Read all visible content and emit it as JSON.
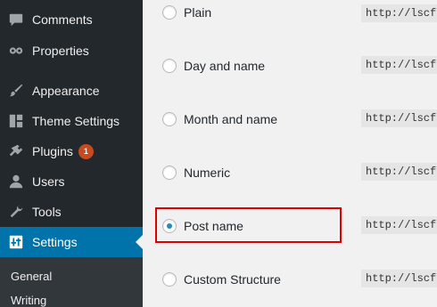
{
  "sidebar": {
    "items": [
      {
        "label": "Comments",
        "icon": "comment-icon"
      },
      {
        "label": "Properties",
        "icon": "owl-icon"
      },
      {
        "label": "Appearance",
        "icon": "paintbrush-icon"
      },
      {
        "label": "Theme Settings",
        "icon": "layout-icon"
      },
      {
        "label": "Plugins",
        "icon": "plugin-icon",
        "badge": "1"
      },
      {
        "label": "Users",
        "icon": "user-icon"
      },
      {
        "label": "Tools",
        "icon": "wrench-icon"
      },
      {
        "label": "Settings",
        "icon": "settings-icon",
        "active": true
      }
    ],
    "submenu": [
      {
        "label": "General"
      },
      {
        "label": "Writing"
      }
    ]
  },
  "permalinks": {
    "options": [
      {
        "label": "Plain",
        "code": "http://lscf.",
        "checked": false
      },
      {
        "label": "Day and name",
        "code": "http://lscf.",
        "checked": false
      },
      {
        "label": "Month and name",
        "code": "http://lscf.",
        "checked": false
      },
      {
        "label": "Numeric",
        "code": "http://lscf.",
        "checked": false
      },
      {
        "label": "Post name",
        "code": "http://lscf.",
        "checked": true
      },
      {
        "label": "Custom Structure",
        "code": "http://lscf.",
        "checked": false
      }
    ]
  },
  "colors": {
    "sidebar_bg": "#23282d",
    "active_bg": "#0073aa",
    "highlight_border": "#e00000",
    "badge_bg": "#ca4a1f"
  }
}
